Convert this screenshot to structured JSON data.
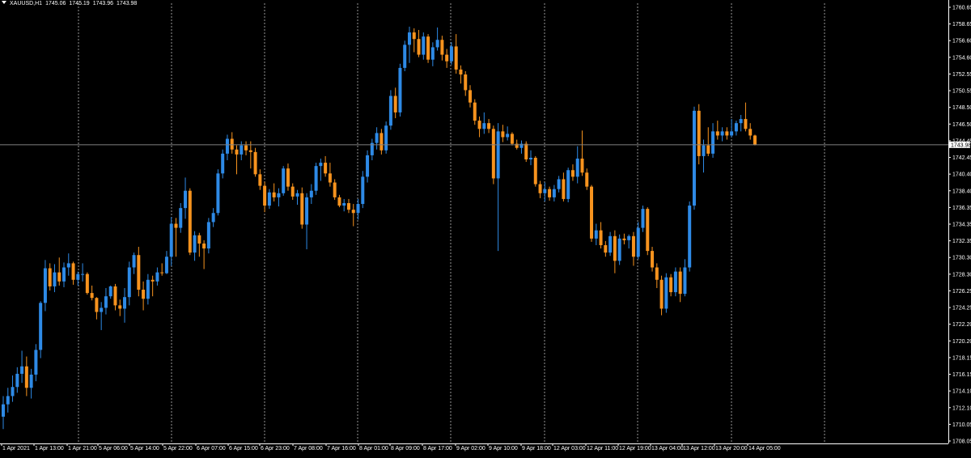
{
  "header": {
    "symbol": "XAUUSD,H1",
    "open": "1745.06",
    "high": "1745.19",
    "low": "1743.96",
    "close": "1743.98"
  },
  "colors": {
    "background": "#000000",
    "bull": "#2e8ae6",
    "bear": "#f7931e",
    "grid": "#c8c8c8",
    "axis": "#ffffff",
    "price_line": "#808080"
  },
  "chart_data": {
    "type": "candlestick",
    "ylim": [
      1708.05,
      1761.0
    ],
    "price_ticks": [
      "1760.65",
      "1758.65",
      "1756.60",
      "1754.60",
      "1752.55",
      "1750.55",
      "1748.50",
      "1746.50",
      "1744.45",
      "1742.45",
      "1740.40",
      "1738.40",
      "1736.35",
      "1734.35",
      "1732.35",
      "1730.30",
      "1728.30",
      "1726.25",
      "1724.25",
      "1722.20",
      "1720.20",
      "1718.15",
      "1716.15",
      "1714.10",
      "1712.10",
      "1710.05",
      "1708.05"
    ],
    "current_price": 1743.98,
    "current_price_label": "1743.98",
    "time_labels": [
      "1 Apr 2021",
      "1 Apr 13:00",
      "1 Apr 21:00",
      "5 Apr 06:00",
      "5 Apr 14:00",
      "5 Apr 22:00",
      "6 Apr 07:00",
      "6 Apr 15:00",
      "6 Apr 23:00",
      "7 Apr 08:00",
      "7 Apr 16:00",
      "8 Apr 01:00",
      "8 Apr 09:00",
      "8 Apr 17:00",
      "9 Apr 02:00",
      "9 Apr 10:00",
      "9 Apr 18:00",
      "12 Apr 03:00",
      "12 Apr 11:00",
      "12 Apr 19:00",
      "13 Apr 04:00",
      "13 Apr 12:00",
      "13 Apr 20:00",
      "14 Apr 05:00"
    ],
    "candles": [
      [
        1711,
        1713.5,
        1709.5,
        1712.5
      ],
      [
        1712.5,
        1714.5,
        1711.5,
        1713.5
      ],
      [
        1713.5,
        1716,
        1712.8,
        1714.6
      ],
      [
        1714.6,
        1717,
        1713.9,
        1716.2
      ],
      [
        1716.2,
        1719,
        1715.1,
        1717.1
      ],
      [
        1717.1,
        1718.3,
        1713.5,
        1714.5
      ],
      [
        1714.5,
        1716.8,
        1713.2,
        1716.1
      ],
      [
        1716.1,
        1719.8,
        1715.3,
        1719.1
      ],
      [
        1719.1,
        1725,
        1718.1,
        1724.8
      ],
      [
        1724.8,
        1730,
        1723.8,
        1729
      ],
      [
        1729,
        1729.6,
        1726.3,
        1726.8
      ],
      [
        1726.8,
        1729.5,
        1726.1,
        1728.5
      ],
      [
        1728.5,
        1730.3,
        1726.9,
        1727.4
      ],
      [
        1727.4,
        1729.7,
        1726.7,
        1729.1
      ],
      [
        1729.1,
        1730.8,
        1728.1,
        1729.6
      ],
      [
        1729.6,
        1729.8,
        1727,
        1727.6
      ],
      [
        1727.6,
        1728.6,
        1726.9,
        1728.3
      ],
      [
        1728.3,
        1729.6,
        1727.4,
        1728.3
      ],
      [
        1728.3,
        1728.5,
        1725.8,
        1726
      ],
      [
        1726,
        1726.9,
        1725.1,
        1725.4
      ],
      [
        1725.4,
        1725.5,
        1722.8,
        1723.7
      ],
      [
        1723.7,
        1724.9,
        1721.5,
        1724.2
      ],
      [
        1724.2,
        1726.6,
        1723.4,
        1725.6
      ],
      [
        1725.6,
        1726.9,
        1725.3,
        1726.8
      ],
      [
        1726.8,
        1727.1,
        1723.9,
        1724.5
      ],
      [
        1724.5,
        1725.2,
        1723.2,
        1724.1
      ],
      [
        1724.1,
        1726.6,
        1722.4,
        1725.5
      ],
      [
        1725.5,
        1729.8,
        1724.5,
        1729.1
      ],
      [
        1729.1,
        1730.9,
        1728.3,
        1730.6
      ],
      [
        1730.6,
        1731.6,
        1725.6,
        1726.4
      ],
      [
        1726.4,
        1727.4,
        1723.9,
        1725.3
      ],
      [
        1725.3,
        1728.3,
        1724.6,
        1727.6
      ],
      [
        1727.6,
        1728.1,
        1725.6,
        1727.4
      ],
      [
        1727.4,
        1729.1,
        1726.9,
        1728.5
      ],
      [
        1728.5,
        1729.6,
        1728.1,
        1728.4
      ],
      [
        1728.4,
        1731.1,
        1728.3,
        1730.4
      ],
      [
        1730.4,
        1735.2,
        1729.3,
        1734.4
      ],
      [
        1734.4,
        1735.1,
        1730.4,
        1733.9
      ],
      [
        1733.9,
        1736.9,
        1733.3,
        1736.3
      ],
      [
        1736.3,
        1740,
        1735,
        1738.4
      ],
      [
        1738.4,
        1738.7,
        1730.6,
        1730.9
      ],
      [
        1730.9,
        1733.5,
        1729.9,
        1733
      ],
      [
        1733,
        1733.3,
        1730.4,
        1732
      ],
      [
        1732,
        1732.4,
        1728.9,
        1731.4
      ],
      [
        1731.4,
        1735.1,
        1730.8,
        1734.6
      ],
      [
        1734.6,
        1736.3,
        1734,
        1735.7
      ],
      [
        1735.7,
        1741,
        1735.4,
        1740.5
      ],
      [
        1740.5,
        1743.4,
        1739.9,
        1742.9
      ],
      [
        1742.9,
        1745.2,
        1742.1,
        1744.7
      ],
      [
        1744.7,
        1745.5,
        1742.9,
        1743.4
      ],
      [
        1743.4,
        1743.9,
        1740.4,
        1742.8
      ],
      [
        1742.8,
        1744.4,
        1742.1,
        1743.9
      ],
      [
        1743.9,
        1744.4,
        1742.7,
        1743.3
      ],
      [
        1743.3,
        1744.4,
        1741.1,
        1743.1
      ],
      [
        1743.1,
        1743.6,
        1740.1,
        1740.4
      ],
      [
        1740.4,
        1741,
        1738.5,
        1739
      ],
      [
        1739,
        1739.5,
        1735.8,
        1736.6
      ],
      [
        1736.6,
        1738.6,
        1736.2,
        1738.2
      ],
      [
        1738.2,
        1739.3,
        1737.1,
        1737.6
      ],
      [
        1737.6,
        1738.7,
        1736.5,
        1738.1
      ],
      [
        1738.1,
        1741.4,
        1737.8,
        1741.1
      ],
      [
        1741.1,
        1741.7,
        1738.4,
        1738.9
      ],
      [
        1738.9,
        1739.3,
        1737.3,
        1737.7
      ],
      [
        1737.7,
        1738.5,
        1736.7,
        1738.1
      ],
      [
        1738.1,
        1738.8,
        1733.8,
        1734.3
      ],
      [
        1734.3,
        1738.1,
        1731.3,
        1737.6
      ],
      [
        1737.6,
        1739.2,
        1736.8,
        1738.4
      ],
      [
        1738.4,
        1741.8,
        1737.9,
        1741.4
      ],
      [
        1741.4,
        1742.3,
        1739.6,
        1741.8
      ],
      [
        1741.8,
        1742.6,
        1740.1,
        1740.5
      ],
      [
        1740.5,
        1741.8,
        1738.9,
        1739.4
      ],
      [
        1739.4,
        1739.8,
        1737.3,
        1737.6
      ],
      [
        1737.6,
        1737.9,
        1736.4,
        1736.6
      ],
      [
        1736.6,
        1737.4,
        1735.9,
        1736.9
      ],
      [
        1736.9,
        1737.4,
        1735.7,
        1736.1
      ],
      [
        1736.1,
        1736.8,
        1734.1,
        1735.7
      ],
      [
        1735.7,
        1737.4,
        1734.9,
        1736.8
      ],
      [
        1736.8,
        1740.8,
        1736.3,
        1740.1
      ],
      [
        1740.1,
        1743.3,
        1739.4,
        1742.7
      ],
      [
        1742.7,
        1744.7,
        1742.1,
        1744.2
      ],
      [
        1744.2,
        1746.1,
        1743.4,
        1745.4
      ],
      [
        1745.4,
        1745.9,
        1742.8,
        1743.3
      ],
      [
        1743.3,
        1746.8,
        1742.9,
        1746.3
      ],
      [
        1746.3,
        1750.6,
        1745.8,
        1749.9
      ],
      [
        1749.9,
        1750.9,
        1747.2,
        1747.9
      ],
      [
        1747.9,
        1753.8,
        1747.4,
        1753.3
      ],
      [
        1753.3,
        1756.6,
        1752.9,
        1756.1
      ],
      [
        1756.1,
        1758.3,
        1753.9,
        1757.6
      ],
      [
        1757.6,
        1758.1,
        1755.2,
        1756.8
      ],
      [
        1756.8,
        1757.9,
        1754.6,
        1754.9
      ],
      [
        1754.9,
        1757.6,
        1754.3,
        1757.1
      ],
      [
        1757.1,
        1757.4,
        1753.9,
        1754.3
      ],
      [
        1754.3,
        1756.4,
        1753.5,
        1755.8
      ],
      [
        1755.8,
        1758.2,
        1755.4,
        1756.7
      ],
      [
        1756.7,
        1757.2,
        1754.2,
        1754.9
      ],
      [
        1754.9,
        1755.6,
        1753.3,
        1754.1
      ],
      [
        1754.1,
        1756.4,
        1753.7,
        1755.9
      ],
      [
        1755.9,
        1757.4,
        1752.6,
        1753.1
      ],
      [
        1753.1,
        1753.6,
        1751.4,
        1752.5
      ],
      [
        1752.5,
        1752.9,
        1749.9,
        1750.6
      ],
      [
        1750.6,
        1751.2,
        1748.5,
        1749.1
      ],
      [
        1749.1,
        1749.5,
        1746.4,
        1746.9
      ],
      [
        1746.9,
        1747.4,
        1744.9,
        1745.9
      ],
      [
        1745.9,
        1747.9,
        1745.3,
        1746.6
      ],
      [
        1746.6,
        1747.1,
        1745.4,
        1745.9
      ],
      [
        1745.9,
        1746.3,
        1739.2,
        1739.9
      ],
      [
        1739.9,
        1746.6,
        1731.1,
        1745.6
      ],
      [
        1745.6,
        1746.4,
        1744.3,
        1744.9
      ],
      [
        1744.9,
        1746.2,
        1744.5,
        1745.3
      ],
      [
        1745.3,
        1745.5,
        1743.9,
        1744.1
      ],
      [
        1744.1,
        1744.6,
        1743.4,
        1743.6
      ],
      [
        1743.6,
        1744.5,
        1742.9,
        1744.1
      ],
      [
        1744.1,
        1744.4,
        1741.9,
        1742.2
      ],
      [
        1742.2,
        1743.3,
        1741.5,
        1742.4
      ],
      [
        1742.4,
        1742.6,
        1738.9,
        1739.2
      ],
      [
        1739.2,
        1739.6,
        1737.5,
        1738.1
      ],
      [
        1738.1,
        1739.4,
        1737.1,
        1738.6
      ],
      [
        1738.6,
        1738.9,
        1737.2,
        1737.6
      ],
      [
        1737.6,
        1739.1,
        1737.1,
        1738.6
      ],
      [
        1738.6,
        1740.2,
        1738.2,
        1739.8
      ],
      [
        1739.8,
        1740.6,
        1737.1,
        1737.4
      ],
      [
        1737.4,
        1741.2,
        1737,
        1740.9
      ],
      [
        1740.9,
        1741.6,
        1739.6,
        1740.1
      ],
      [
        1740.1,
        1743.8,
        1739.3,
        1742.3
      ],
      [
        1742.3,
        1745.7,
        1740.2,
        1740.6
      ],
      [
        1740.6,
        1741.1,
        1738.5,
        1738.9
      ],
      [
        1738.9,
        1739.1,
        1732.2,
        1732.6
      ],
      [
        1732.6,
        1734.4,
        1731.8,
        1733.6
      ],
      [
        1733.6,
        1734.6,
        1731.4,
        1731.8
      ],
      [
        1731.8,
        1732.3,
        1730.4,
        1730.9
      ],
      [
        1730.9,
        1733.4,
        1730.5,
        1732.9
      ],
      [
        1732.9,
        1733.6,
        1728.4,
        1729.9
      ],
      [
        1729.9,
        1733.1,
        1729.4,
        1732.6
      ],
      [
        1732.6,
        1733.2,
        1731.9,
        1732.4
      ],
      [
        1732.4,
        1733.1,
        1731.4,
        1732.9
      ],
      [
        1732.9,
        1733.4,
        1729.3,
        1730.4
      ],
      [
        1730.4,
        1734.6,
        1730.1,
        1733.9
      ],
      [
        1733.9,
        1736.6,
        1733.4,
        1736.2
      ],
      [
        1736.2,
        1736.4,
        1730.6,
        1731.1
      ],
      [
        1731.1,
        1731.6,
        1728.6,
        1729.1
      ],
      [
        1729.1,
        1729.6,
        1726.6,
        1727.6
      ],
      [
        1727.6,
        1728.1,
        1723.3,
        1724.1
      ],
      [
        1724.1,
        1728.4,
        1723.6,
        1727.9
      ],
      [
        1727.9,
        1728.3,
        1725.6,
        1726.1
      ],
      [
        1726.1,
        1729.1,
        1725.6,
        1728.6
      ],
      [
        1728.6,
        1729.1,
        1724.9,
        1725.9
      ],
      [
        1725.9,
        1730.1,
        1725.6,
        1729.1
      ],
      [
        1729.1,
        1737.1,
        1728.6,
        1736.6
      ],
      [
        1736.6,
        1748.6,
        1736.1,
        1748.1
      ],
      [
        1748.1,
        1748.9,
        1741.6,
        1742.6
      ],
      [
        1742.6,
        1744.6,
        1740.6,
        1743.9
      ],
      [
        1743.9,
        1746.1,
        1742.6,
        1742.9
      ],
      [
        1742.9,
        1746.6,
        1742.4,
        1745.6
      ],
      [
        1745.6,
        1746.9,
        1744.6,
        1745.1
      ],
      [
        1745.1,
        1746.1,
        1744.4,
        1745.6
      ],
      [
        1745.6,
        1746.1,
        1744.6,
        1745.1
      ],
      [
        1745.1,
        1747.1,
        1744.9,
        1745.6
      ],
      [
        1745.6,
        1746.9,
        1745.1,
        1746.6
      ],
      [
        1746.6,
        1747.6,
        1745.6,
        1747.1
      ],
      [
        1747.1,
        1749.1,
        1745.6,
        1745.9
      ],
      [
        1745.9,
        1746.6,
        1744.6,
        1745.1
      ],
      [
        1745.1,
        1745.2,
        1743.9,
        1743.98
      ]
    ]
  }
}
